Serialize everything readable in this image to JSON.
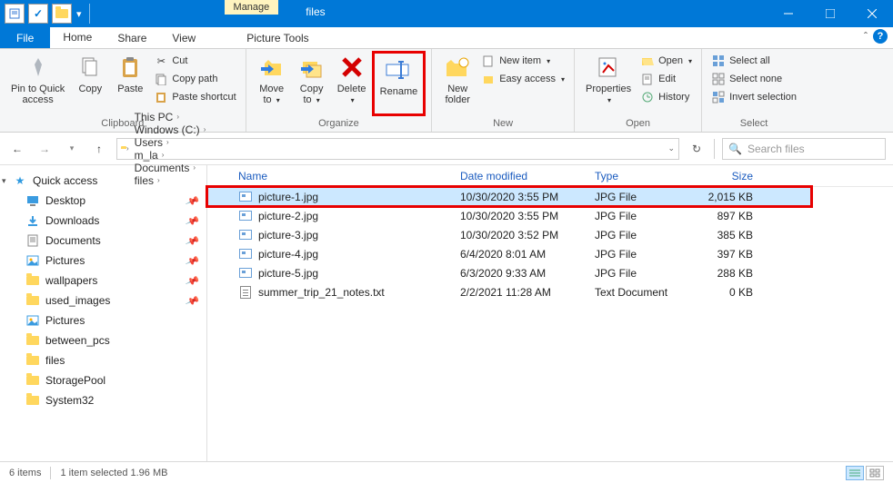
{
  "window": {
    "title": "files"
  },
  "contextual_tab": {
    "chip": "Manage",
    "tool": "Picture Tools"
  },
  "tabs": {
    "file": "File",
    "home": "Home",
    "share": "Share",
    "view": "View"
  },
  "ribbon": {
    "clipboard": {
      "label": "Clipboard",
      "pin": "Pin to Quick\naccess",
      "copy": "Copy",
      "paste": "Paste",
      "cut": "Cut",
      "copy_path": "Copy path",
      "paste_shortcut": "Paste shortcut"
    },
    "organize": {
      "label": "Organize",
      "move_to": "Move\nto",
      "copy_to": "Copy\nto",
      "delete": "Delete",
      "rename": "Rename"
    },
    "new": {
      "label": "New",
      "new_folder": "New\nfolder",
      "new_item": "New item",
      "easy_access": "Easy access"
    },
    "open": {
      "label": "Open",
      "properties": "Properties",
      "open": "Open",
      "edit": "Edit",
      "history": "History"
    },
    "select": {
      "label": "Select",
      "select_all": "Select all",
      "select_none": "Select none",
      "invert": "Invert selection"
    }
  },
  "breadcrumbs": [
    "This PC",
    "Windows (C:)",
    "Users",
    "m_la",
    "Documents",
    "files"
  ],
  "search_placeholder": "Search files",
  "sidebar": {
    "quick_access": "Quick access",
    "items": [
      {
        "label": "Desktop",
        "pinned": true
      },
      {
        "label": "Downloads",
        "pinned": true
      },
      {
        "label": "Documents",
        "pinned": true
      },
      {
        "label": "Pictures",
        "pinned": true
      },
      {
        "label": "wallpapers",
        "pinned": true
      },
      {
        "label": "used_images",
        "pinned": true
      },
      {
        "label": "Pictures",
        "pinned": false
      },
      {
        "label": "between_pcs",
        "pinned": false
      },
      {
        "label": "files",
        "pinned": false
      },
      {
        "label": "StoragePool",
        "pinned": false
      },
      {
        "label": "System32",
        "pinned": false
      }
    ]
  },
  "columns": {
    "name": "Name",
    "date": "Date modified",
    "type": "Type",
    "size": "Size"
  },
  "files": [
    {
      "name": "picture-1.jpg",
      "date": "10/30/2020 3:55 PM",
      "type": "JPG File",
      "size": "2,015 KB",
      "kind": "img",
      "selected": true
    },
    {
      "name": "picture-2.jpg",
      "date": "10/30/2020 3:55 PM",
      "type": "JPG File",
      "size": "897 KB",
      "kind": "img"
    },
    {
      "name": "picture-3.jpg",
      "date": "10/30/2020 3:52 PM",
      "type": "JPG File",
      "size": "385 KB",
      "kind": "img"
    },
    {
      "name": "picture-4.jpg",
      "date": "6/4/2020 8:01 AM",
      "type": "JPG File",
      "size": "397 KB",
      "kind": "img"
    },
    {
      "name": "picture-5.jpg",
      "date": "6/3/2020 9:33 AM",
      "type": "JPG File",
      "size": "288 KB",
      "kind": "img"
    },
    {
      "name": "summer_trip_21_notes.txt",
      "date": "2/2/2021 11:28 AM",
      "type": "Text Document",
      "size": "0 KB",
      "kind": "txt"
    }
  ],
  "status": {
    "count": "6 items",
    "selection": "1 item selected  1.96 MB"
  }
}
